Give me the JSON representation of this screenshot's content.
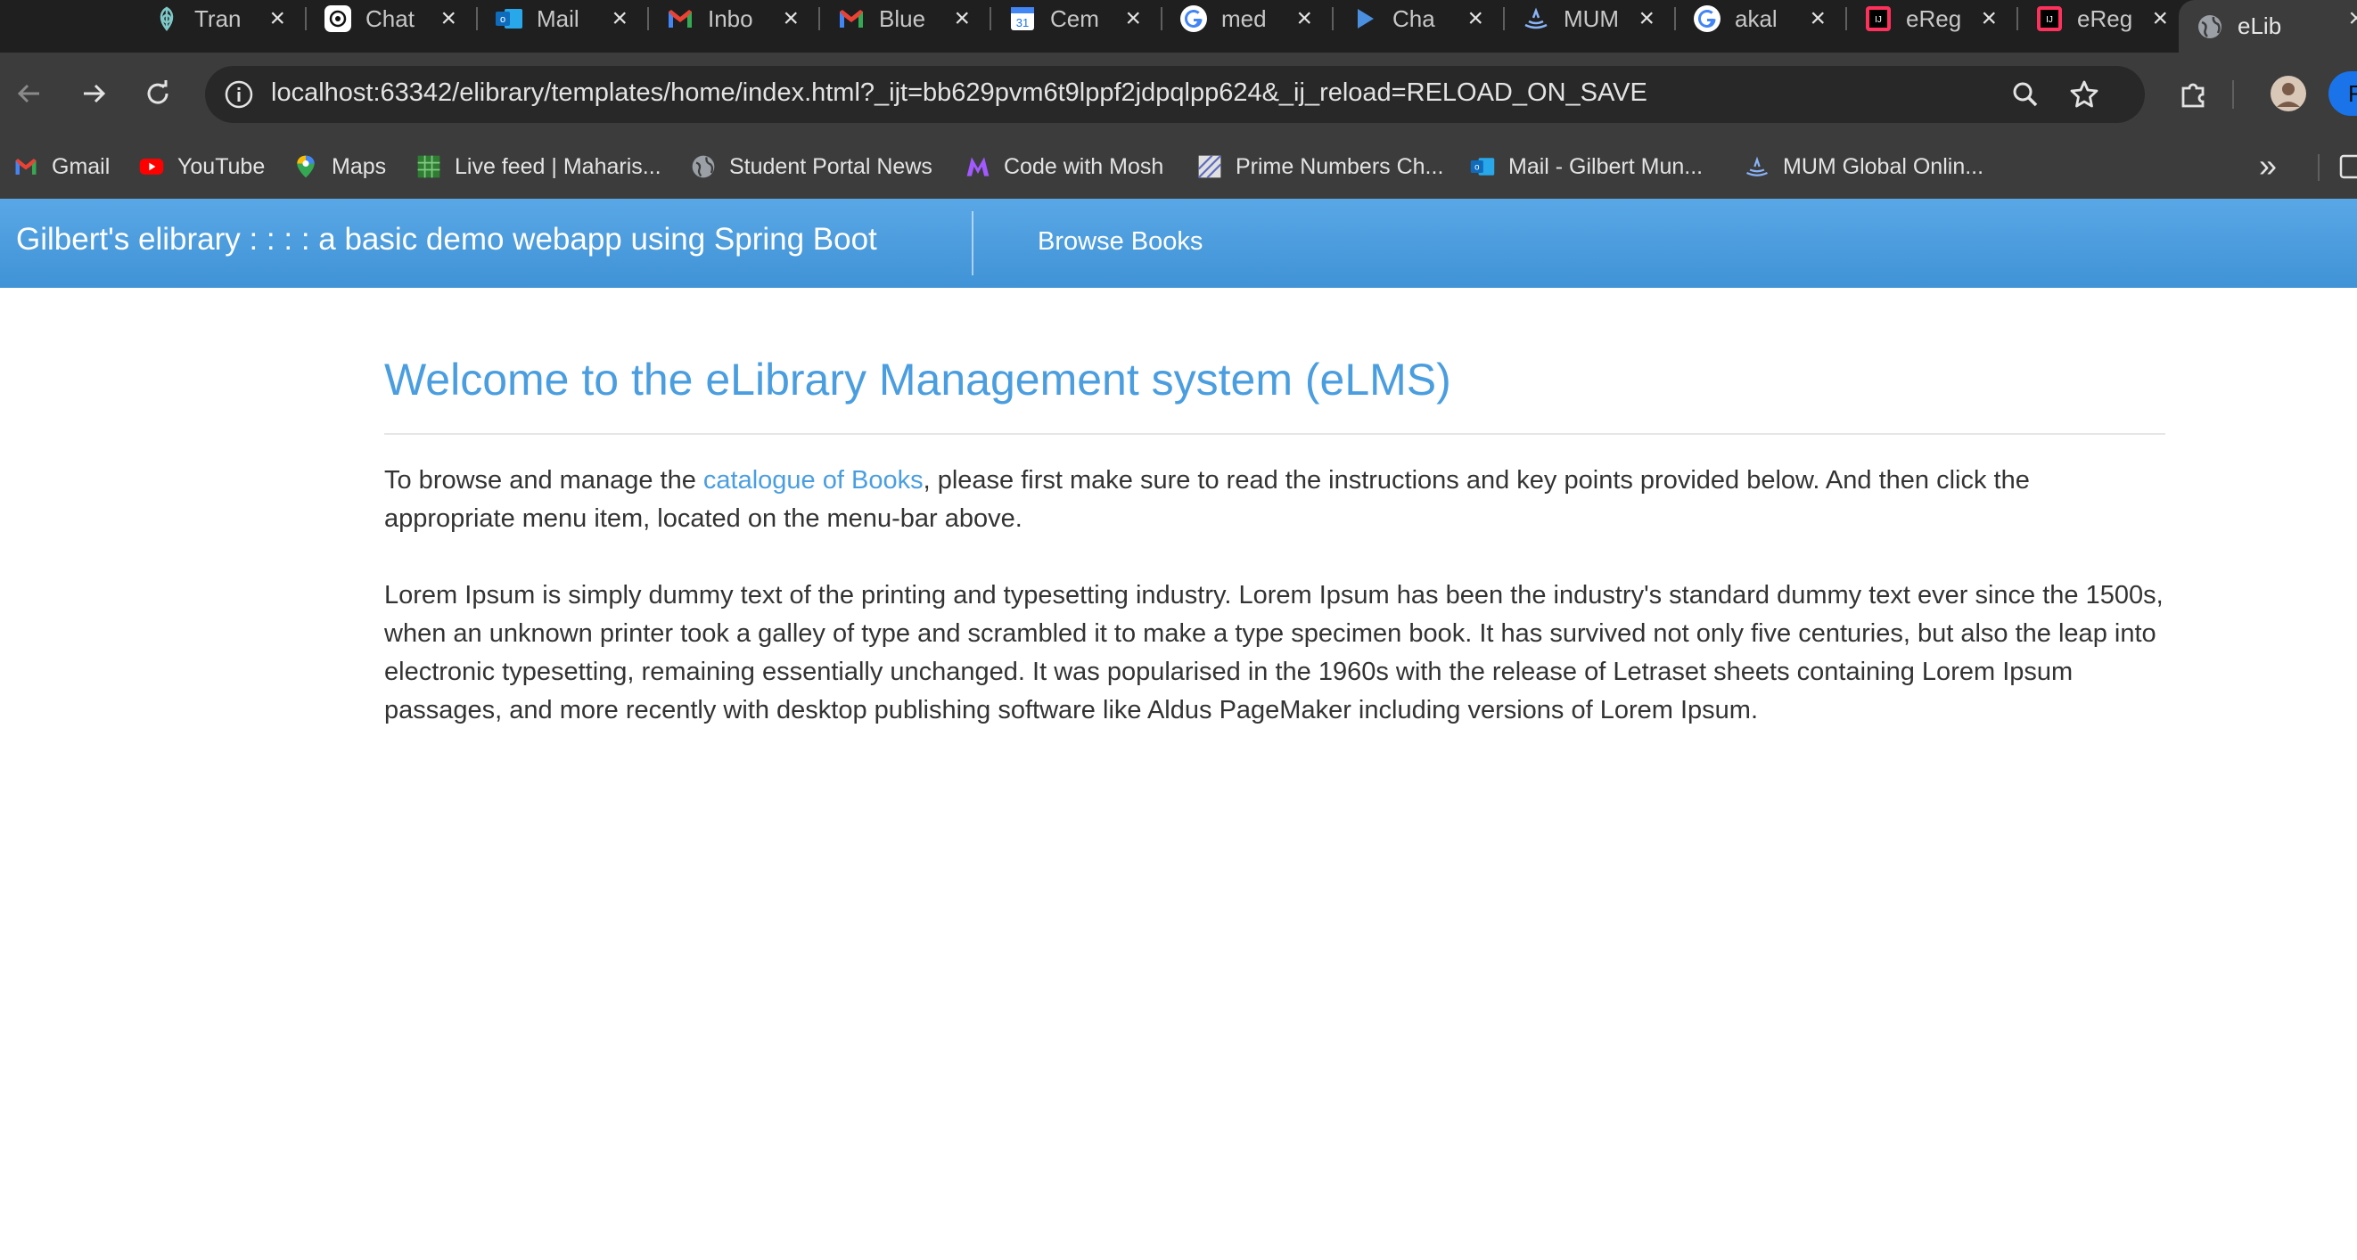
{
  "browser": {
    "tabs": [
      {
        "title": "Tran",
        "icon": "perplexity-icon"
      },
      {
        "title": "Chat",
        "icon": "chatgpt-icon"
      },
      {
        "title": "Mail",
        "icon": "outlook-icon"
      },
      {
        "title": "Inbo",
        "icon": "gmail-icon"
      },
      {
        "title": "Blue",
        "icon": "gmail-icon"
      },
      {
        "title": "Cem",
        "icon": "calendar-icon"
      },
      {
        "title": "med",
        "icon": "google-icon"
      },
      {
        "title": "Cha",
        "icon": "play-icon"
      },
      {
        "title": "MUM",
        "icon": "mum-icon"
      },
      {
        "title": "akal",
        "icon": "google-icon"
      },
      {
        "title": "eReg",
        "icon": "intellij-icon"
      },
      {
        "title": "eReg",
        "icon": "intellij-icon"
      },
      {
        "title": "eLib",
        "icon": "globe-icon",
        "active": true
      }
    ],
    "close_glyph": "×",
    "url": "localhost:63342/elibrary/templates/home/index.html?_ijt=bb629pvm6t9lppf2jdpqlpp624&_ij_reload=RELOAD_ON_SAVE",
    "profile_initial": "F",
    "bookmarks": [
      {
        "label": "Gmail",
        "icon": "gmail-icon"
      },
      {
        "label": "YouTube",
        "icon": "youtube-icon"
      },
      {
        "label": "Maps",
        "icon": "maps-icon"
      },
      {
        "label": "Live feed | Maharis...",
        "icon": "live-feed-icon"
      },
      {
        "label": "Student Portal News",
        "icon": "globe-icon"
      },
      {
        "label": "Code with Mosh",
        "icon": "mosh-icon"
      },
      {
        "label": "Prime Numbers Ch...",
        "icon": "prime-icon"
      },
      {
        "label": "Mail - Gilbert Mun...",
        "icon": "outlook-icon"
      },
      {
        "label": "MUM Global Onlin...",
        "icon": "mum-icon"
      }
    ],
    "overflow_glyph": "»"
  },
  "navbar": {
    "brand": "Gilbert's elibrary : : : : a basic demo webapp using Spring Boot",
    "browse_books": "Browse Books"
  },
  "main": {
    "heading": "Welcome to the eLibrary Management system (eLMS)",
    "intro_before": "To browse and manage the ",
    "intro_link": "catalogue of Books",
    "intro_after": ", please first make sure to read the instructions and key points provided below. And then click the appropriate menu item, located on the menu-bar above.",
    "lorem": "Lorem Ipsum is simply dummy text of the printing and typesetting industry. Lorem Ipsum has been the industry's standard dummy text ever since the 1500s, when an unknown printer took a galley of type and scrambled it to make a type specimen book. It has survived not only five centuries, but also the leap into electronic typesetting, remaining essentially unchanged. It was popularised in the 1960s with the release of Letraset sheets containing Lorem Ipsum passages, and more recently with desktop publishing software like Aldus PageMaker including versions of Lorem Ipsum."
  },
  "colors": {
    "navbar": "#4a9ee0",
    "accent": "#4a9ee0",
    "chrome_dark": "#1f1f1f",
    "chrome_toolbar": "#3c3c3c"
  }
}
